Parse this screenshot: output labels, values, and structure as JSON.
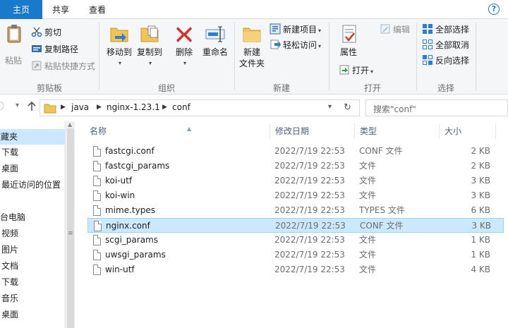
{
  "tabs": [
    {
      "label": "主页",
      "active": true
    },
    {
      "label": "共享",
      "active": false
    },
    {
      "label": "查看",
      "active": false
    }
  ],
  "help_icon": "help-icon",
  "ribbon": {
    "clipboard": {
      "pin_label": "粘贴",
      "cut_label": "剪切",
      "copy_path_label": "复制路径",
      "paste_shortcut_label": "粘贴快捷方式",
      "group_label": "剪贴板"
    },
    "organize": {
      "move_to_label": "移动到",
      "copy_to_label": "复制到",
      "delete_label": "删除",
      "rename_label": "重命名",
      "group_label": "组织"
    },
    "new": {
      "new_folder_line1": "新建",
      "new_folder_line2": "文件夹",
      "new_item_label": "新建项目",
      "easy_access_label": "轻松访问",
      "group_label": "新建"
    },
    "open": {
      "properties_label": "属性",
      "open_label": "打开",
      "edit_label": "编辑",
      "group_label": "打开"
    },
    "select": {
      "select_all_label": "全部选择",
      "select_none_label": "全部取消",
      "invert_label": "反向选择",
      "group_label": "选择"
    }
  },
  "address": {
    "crumbs": [
      "java",
      "nginx-1.23.1",
      "conf"
    ]
  },
  "search": {
    "placeholder": "搜索\"conf\""
  },
  "nav_pane": {
    "items": [
      "收藏夹",
      "下载",
      "桌面",
      "最近访问的位置",
      "这台电脑",
      "视频",
      "图片",
      "文档",
      "下载",
      "音乐",
      "桌面"
    ]
  },
  "columns": {
    "name": "名称",
    "date": "修改日期",
    "type": "类型",
    "size": "大小"
  },
  "files": [
    {
      "name": "fastcgi.conf",
      "date": "2022/7/19 22:53",
      "type": "CONF 文件",
      "size": "2 KB",
      "selected": false
    },
    {
      "name": "fastcgi_params",
      "date": "2022/7/19 22:53",
      "type": "文件",
      "size": "2 KB",
      "selected": false
    },
    {
      "name": "koi-utf",
      "date": "2022/7/19 22:53",
      "type": "文件",
      "size": "3 KB",
      "selected": false
    },
    {
      "name": "koi-win",
      "date": "2022/7/19 22:53",
      "type": "文件",
      "size": "3 KB",
      "selected": false
    },
    {
      "name": "mime.types",
      "date": "2022/7/19 22:53",
      "type": "TYPES 文件",
      "size": "6 KB",
      "selected": false
    },
    {
      "name": "nginx.conf",
      "date": "2022/7/19 22:53",
      "type": "CONF 文件",
      "size": "3 KB",
      "selected": true
    },
    {
      "name": "scgi_params",
      "date": "2022/7/19 22:53",
      "type": "文件",
      "size": "1 KB",
      "selected": false
    },
    {
      "name": "uwsgi_params",
      "date": "2022/7/19 22:53",
      "type": "文件",
      "size": "1 KB",
      "selected": false
    },
    {
      "name": "win-utf",
      "date": "2022/7/19 22:53",
      "type": "文件",
      "size": "4 KB",
      "selected": false
    }
  ],
  "colors": {
    "accent": "#1979ca",
    "selection": "#cce8ff",
    "selection_border": "#99d1ff"
  }
}
